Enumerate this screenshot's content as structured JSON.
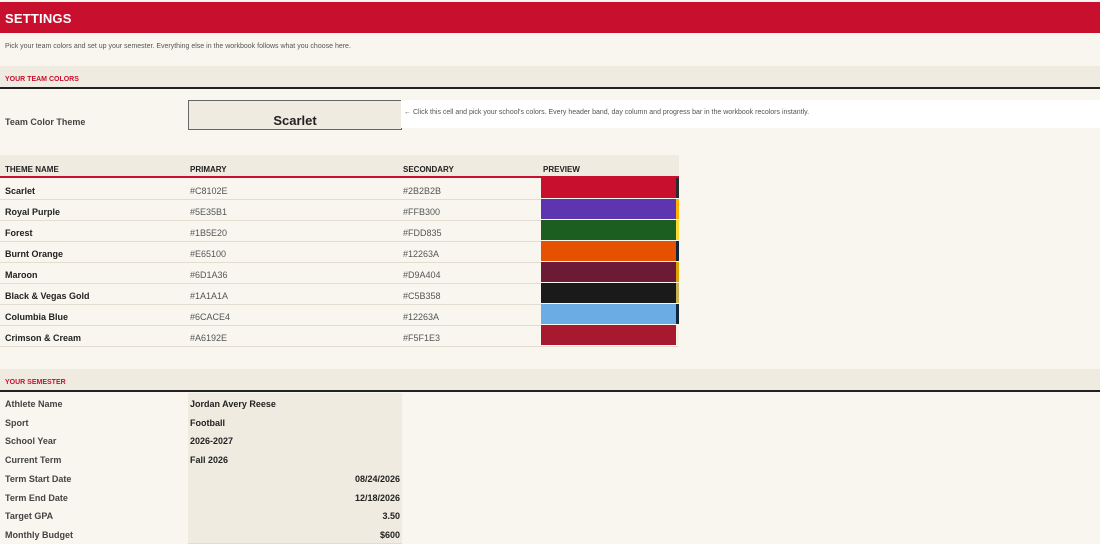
{
  "header": {
    "title": "SETTINGS",
    "subtitle": "Pick your team colors and set up your semester. Everything else in the workbook follows what you choose here."
  },
  "team_colors": {
    "section_label": "YOUR TEAM COLORS",
    "theme_label": "Team Color Theme",
    "theme_value": "Scarlet",
    "hint": "← Click this cell and pick your school's colors. Every header band, day column and progress bar in the workbook recolors instantly.",
    "columns": [
      "THEME NAME",
      "PRIMARY",
      "SECONDARY",
      "PREVIEW"
    ],
    "themes": [
      {
        "name": "Scarlet",
        "primary": "#C8102E",
        "secondary": "#2B2B2B"
      },
      {
        "name": "Royal Purple",
        "primary": "#5E35B1",
        "secondary": "#FFB300"
      },
      {
        "name": "Forest",
        "primary": "#1B5E20",
        "secondary": "#FDD835"
      },
      {
        "name": "Burnt Orange",
        "primary": "#E65100",
        "secondary": "#12263A"
      },
      {
        "name": "Maroon",
        "primary": "#6D1A36",
        "secondary": "#D9A404"
      },
      {
        "name": "Black & Vegas Gold",
        "primary": "#1A1A1A",
        "secondary": "#C5B358"
      },
      {
        "name": "Columbia Blue",
        "primary": "#6CACE4",
        "secondary": "#12263A"
      },
      {
        "name": "Crimson & Cream",
        "primary": "#A6192E",
        "secondary": "#F5F1E3"
      }
    ]
  },
  "semester": {
    "section_label": "YOUR SEMESTER",
    "fields": [
      {
        "label": "Athlete Name",
        "value": "Jordan Avery Reese",
        "align": "left"
      },
      {
        "label": "Sport",
        "value": "Football",
        "align": "left"
      },
      {
        "label": "School Year",
        "value": "2026-2027",
        "align": "left"
      },
      {
        "label": "Current Term",
        "value": "Fall 2026",
        "align": "left"
      },
      {
        "label": "Term Start Date",
        "value": "08/24/2026",
        "align": "right"
      },
      {
        "label": "Term End Date",
        "value": "12/18/2026",
        "align": "right"
      },
      {
        "label": "Target GPA",
        "value": "3.50",
        "align": "right"
      },
      {
        "label": "Monthly Budget",
        "value": "$600",
        "align": "right"
      }
    ]
  },
  "colors": {
    "accent": "#c8102e",
    "band": "#efebe0",
    "background": "#f8f6ef"
  }
}
